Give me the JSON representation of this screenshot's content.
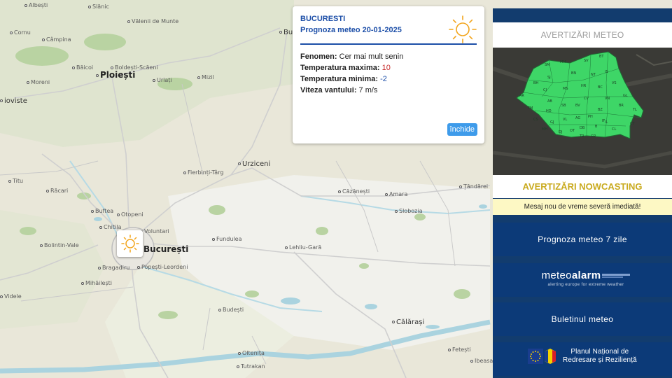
{
  "popup": {
    "city": "BUCURESTI",
    "forecast_title": "Prognoza meteo 20-01-2025",
    "rows": [
      {
        "label": "Fenomen:",
        "value": "Cer mai mult senin",
        "color": "#222222"
      },
      {
        "label": "Temperatura maxima:",
        "value": "10",
        "color": "#c62828"
      },
      {
        "label": "Temperatura minima:",
        "value": "-2",
        "color": "#1d4fa8"
      },
      {
        "label": "Viteza vantului:",
        "value": "7 m/s",
        "color": "#222222"
      }
    ],
    "weather_icon": "sun-icon",
    "close_label": "închide"
  },
  "map": {
    "places": [
      {
        "name": "Albești"
      },
      {
        "name": "Slănic"
      },
      {
        "name": "Vălenii de Munte"
      },
      {
        "name": "Cornu"
      },
      {
        "name": "Câmpina"
      },
      {
        "name": "Buză"
      },
      {
        "name": "Băicoi"
      },
      {
        "name": "Boldești-Scăeni"
      },
      {
        "name": "Moreni"
      },
      {
        "name": "Urlați"
      },
      {
        "name": "Mizil"
      },
      {
        "name": "Ploiești"
      },
      {
        "name": "ioviste"
      },
      {
        "name": "Fierbinți-Târg"
      },
      {
        "name": "Urziceni"
      },
      {
        "name": "Titu"
      },
      {
        "name": "Răcari"
      },
      {
        "name": "Căzănești"
      },
      {
        "name": "Amara"
      },
      {
        "name": "Țăndărei"
      },
      {
        "name": "Buftea"
      },
      {
        "name": "Otopeni"
      },
      {
        "name": "Slobozia"
      },
      {
        "name": "Chitila"
      },
      {
        "name": "Voluntari"
      },
      {
        "name": "Fundulea"
      },
      {
        "name": "Bolintin-Vale"
      },
      {
        "name": "București"
      },
      {
        "name": "Lehliu-Gară"
      },
      {
        "name": "Bragadiru"
      },
      {
        "name": "Popești-Leordeni"
      },
      {
        "name": "Mihăilești"
      },
      {
        "name": "Videle"
      },
      {
        "name": "Budești"
      },
      {
        "name": "Călărași"
      },
      {
        "name": "Oltenița"
      },
      {
        "name": "Fetești"
      },
      {
        "name": "Tutrakan"
      },
      {
        "name": "Ibeasa"
      }
    ]
  },
  "sidebar": {
    "alert_title": "AVERTIZĂRI METEO",
    "map_status_color": "#3ed667",
    "nowcasting_title": "AVERTIZĂRI NOWCASTING",
    "nowcasting_message": "Mesaj nou de vreme severă imediată!",
    "forecast_button": "Prognoza meteo 7 zile",
    "meteoalarm_logo_prefix": "meteo",
    "meteoalarm_logo_suffix": "alarm",
    "meteoalarm_tagline": "alerting europe for extreme weather",
    "bulletin_button": "Buletinul meteo",
    "pnrr_line1": "Planul Național de",
    "pnrr_line2": "Redresare și Reziliență",
    "counties": [
      "SM",
      "MM",
      "SV",
      "BT",
      "BH",
      "SJ",
      "BN",
      "NT",
      "IS",
      "CJ",
      "MS",
      "HR",
      "BC",
      "VS",
      "AR",
      "AB",
      "CV",
      "VN",
      "GL",
      "TM",
      "HD",
      "SB",
      "BV",
      "BZ",
      "BR",
      "CS",
      "GJ",
      "VL",
      "AG",
      "PH",
      "TL",
      "MH",
      "DJ",
      "OT",
      "DB",
      "IL",
      "CT",
      "TR",
      "GR",
      "CL",
      "B",
      "IF"
    ]
  }
}
